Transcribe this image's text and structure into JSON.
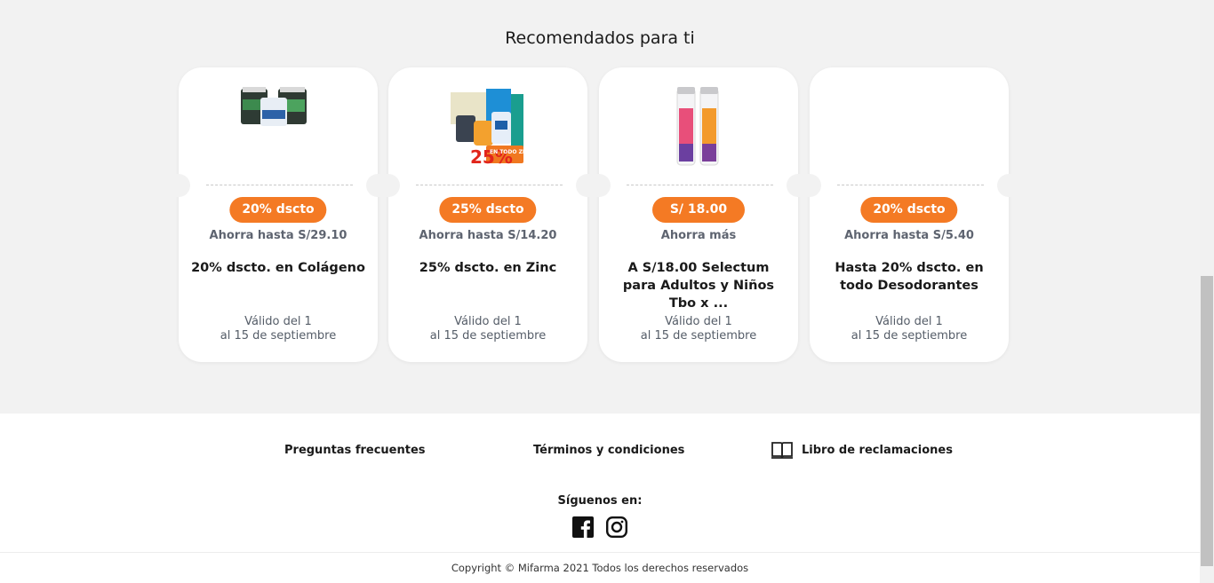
{
  "section": {
    "title": "Recomendados para ti"
  },
  "cards": [
    {
      "badge": "20% dscto",
      "savings": "Ahorra hasta S/29.10",
      "description": "20% dscto. en Colágeno",
      "valid_line1": "Válido del 1",
      "valid_line2": "al 15 de septiembre",
      "image_icon": "collagen-products-image"
    },
    {
      "badge": "25% dscto",
      "savings": "Ahorra hasta S/14.20",
      "description": "25% dscto. en Zinc",
      "valid_line1": "Válido del 1",
      "valid_line2": "al 15 de septiembre",
      "image_icon": "zinc-products-image",
      "image_text_big": "25%",
      "image_text_small": "EN TODO ZINC"
    },
    {
      "badge": "S/ 18.00",
      "savings": "Ahorra más",
      "description": "A S/18.00 Selectum para Adultos y Niños Tbo x ...",
      "valid_line1": "Válido del 1",
      "valid_line2": "al 15 de septiembre",
      "image_icon": "selectum-tubes-image"
    },
    {
      "badge": "20% dscto",
      "savings": "Ahorra hasta S/5.40",
      "description": "Hasta 20% dscto. en todo Desodorantes",
      "valid_line1": "Válido del 1",
      "valid_line2": "al 15 de septiembre",
      "image_icon": ""
    }
  ],
  "footer": {
    "faq": "Preguntas frecuentes",
    "terms": "Términos y condiciones",
    "complaints": "Libro de reclamaciones",
    "follow": "Síguenos en:",
    "copyright": "Copyright © Mifarma 2021 Todos los derechos reservados"
  },
  "colors": {
    "accent": "#f47a24",
    "background": "#f2f2f2",
    "card": "#ffffff"
  }
}
